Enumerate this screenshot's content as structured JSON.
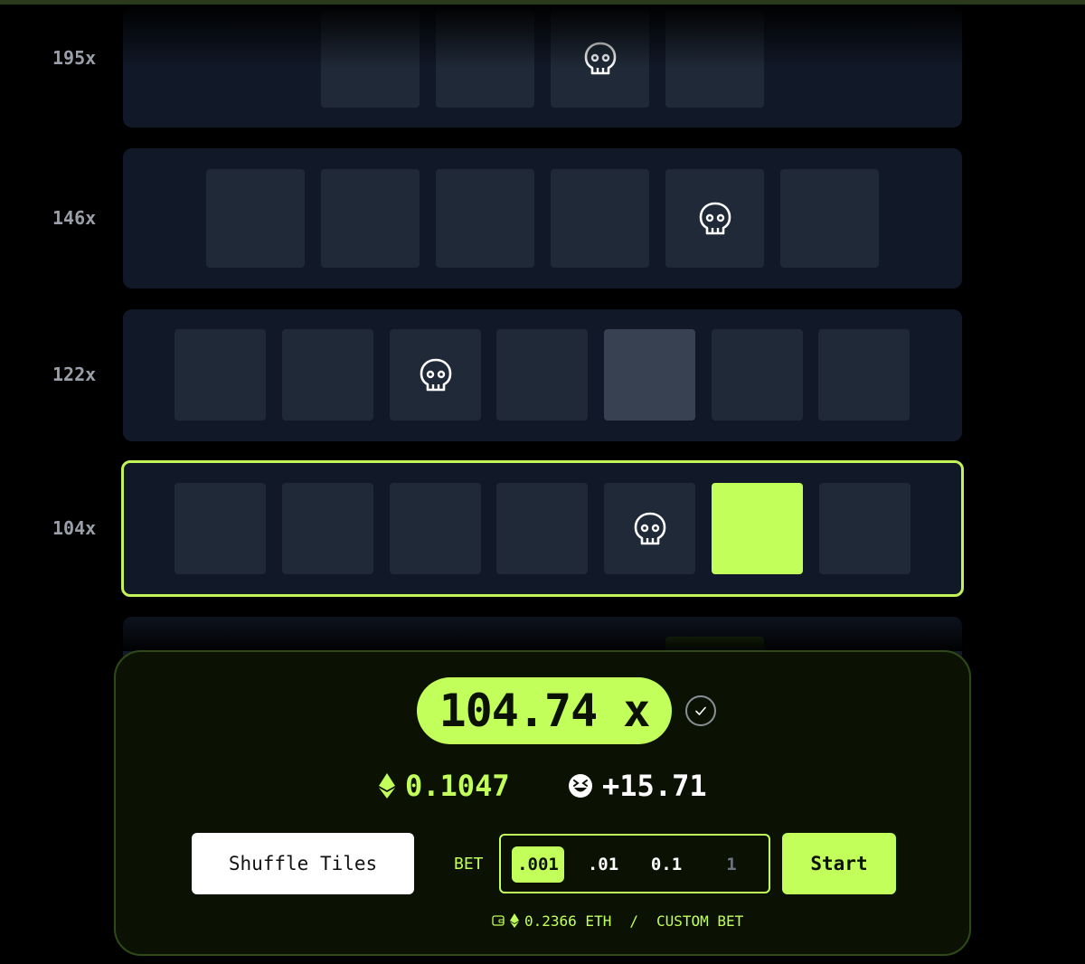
{
  "rows": [
    {
      "multiplier": "195x"
    },
    {
      "multiplier": "146x"
    },
    {
      "multiplier": "122x"
    },
    {
      "multiplier": "104x"
    }
  ],
  "panel": {
    "current_multiplier": "104.74 x",
    "eth_payout": "0.1047",
    "points_payout": "+15.71",
    "shuffle_label": "Shuffle Tiles",
    "bet_label": "BET",
    "bet_options": [
      ".001",
      ".01",
      "0.1",
      "1"
    ],
    "selected_bet": ".001",
    "start_label": "Start",
    "balance": "0.2366 ETH",
    "separator": "/",
    "custom_bet_label": "CUSTOM BET"
  },
  "colors": {
    "accent": "#c2ff5b",
    "tile": "#1f2937",
    "row_bg": "#111827",
    "panel_bg": "#0b1204"
  },
  "icons": {
    "mine": "skull-icon",
    "verified": "check-icon",
    "currency": "eth-icon",
    "points": "emoji-icon",
    "wallet": "wallet-icon"
  }
}
